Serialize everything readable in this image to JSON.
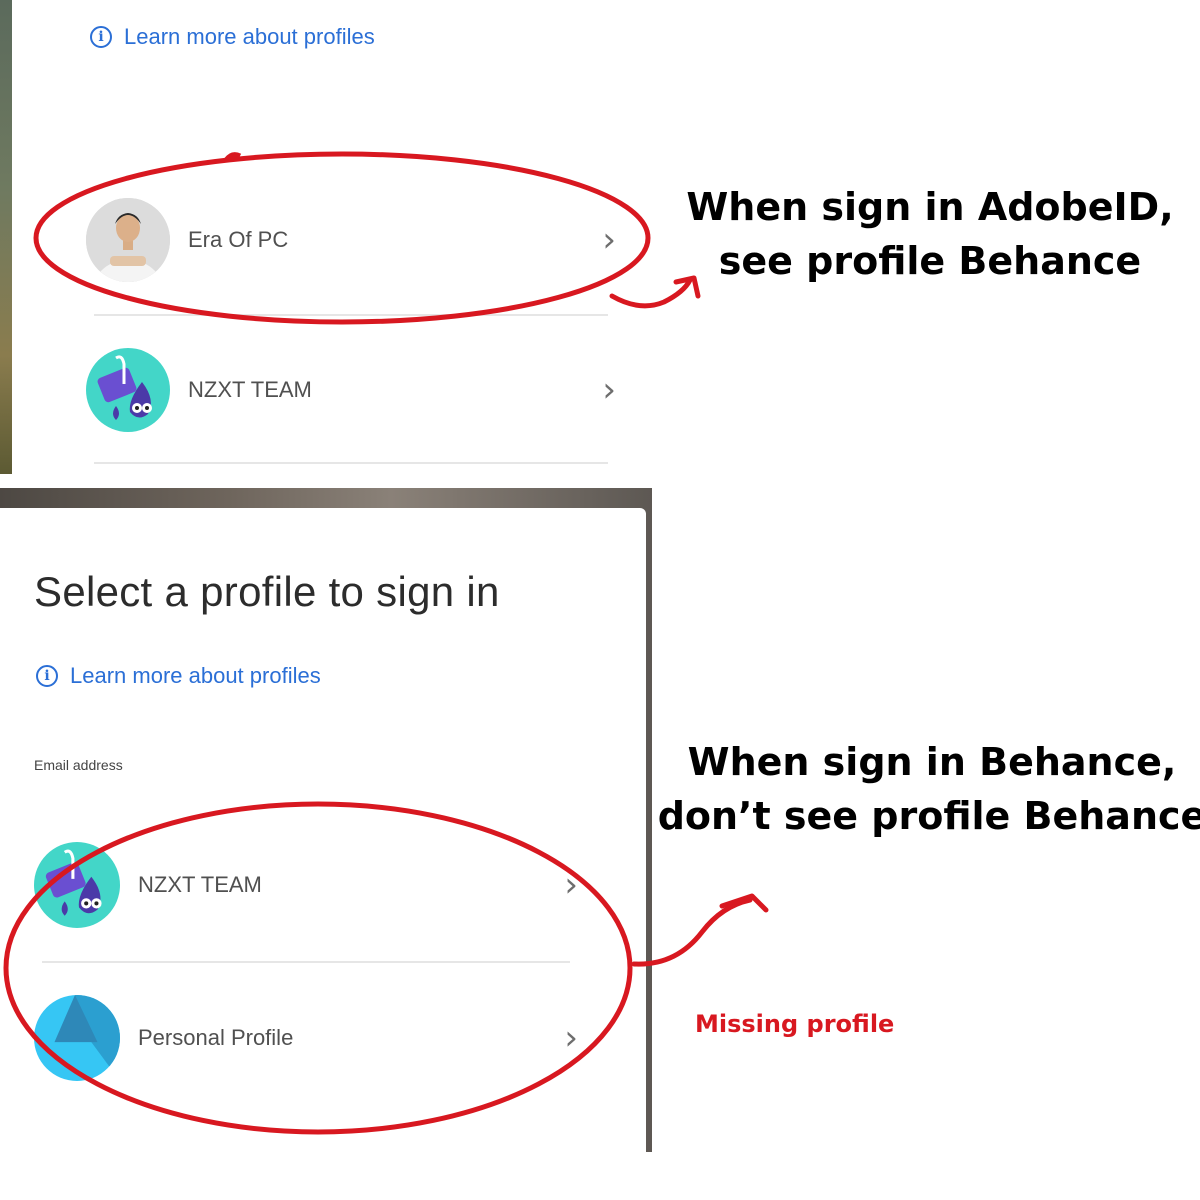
{
  "top_screenshot": {
    "learn_more": "Learn more about profiles",
    "profiles": [
      {
        "name": "Era Of PC",
        "avatar": "person-photo"
      },
      {
        "name": "NZXT TEAM",
        "avatar": "nzxt-team-logo"
      }
    ]
  },
  "bottom_screenshot": {
    "heading": "Select a profile to sign in",
    "learn_more": "Learn more about profiles",
    "email_label": "Email address",
    "profiles": [
      {
        "name": "NZXT TEAM",
        "avatar": "nzxt-team-logo"
      },
      {
        "name": "Personal Profile",
        "avatar": "personal-profile-logo"
      }
    ]
  },
  "annotations": {
    "top_note_line1": "When sign in AdobeID,",
    "top_note_line2": "see profile Behance",
    "bottom_note_line1": "When sign in Behance,",
    "bottom_note_line2": "don’t see profile Behance",
    "missing_label": "Missing profile",
    "highlight_color": "#d81820"
  },
  "icons": {
    "info": "info-icon",
    "chevron": "chevron-right-icon"
  }
}
